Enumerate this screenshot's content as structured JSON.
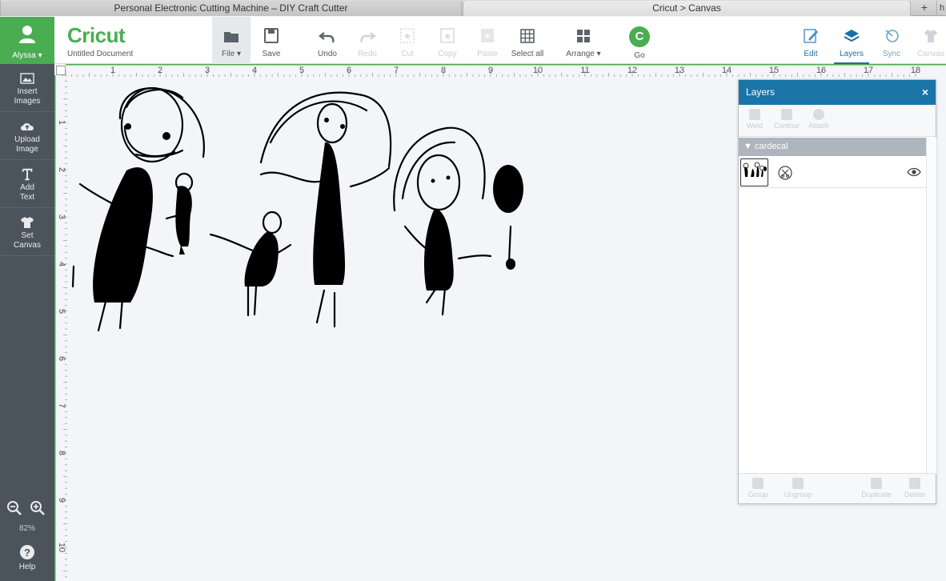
{
  "browser": {
    "tab1_title": "Personal Electronic Cutting Machine – DIY Craft Cutter",
    "tab2_title": "Cricut > Canvas",
    "new_tab": "+"
  },
  "user": {
    "name": "Alyssa"
  },
  "brand": {
    "logo": "Cricut",
    "document_title": "Untitled Document",
    "accent": "#4aad52",
    "blue": "#1b74a8"
  },
  "toolbar": {
    "file": "File",
    "save": "Save",
    "undo": "Undo",
    "redo": "Redo",
    "cut": "Cut",
    "copy": "Copy",
    "paste": "Paste",
    "select_all": "Select all",
    "arrange": "Arrange",
    "go": "Go",
    "go_glyph": "C",
    "edit": "Edit",
    "layers": "Layers",
    "sync": "Sync",
    "canvas": "Canvas"
  },
  "sidebar": {
    "insert_images_1": "Insert",
    "insert_images_2": "Images",
    "upload_image_1": "Upload",
    "upload_image_2": "Image",
    "add_text_1": "Add",
    "add_text_2": "Text",
    "set_canvas_1": "Set",
    "set_canvas_2": "Canvas",
    "zoom": "82%",
    "help": "Help"
  },
  "ruler": {
    "top": [
      "1",
      "2",
      "3",
      "4",
      "5",
      "6",
      "7",
      "8",
      "9",
      "10",
      "11",
      "12",
      "13",
      "14",
      "15",
      "16",
      "17",
      "18"
    ],
    "left": [
      "1",
      "2",
      "3",
      "4",
      "5",
      "6",
      "7",
      "8",
      "9",
      "10"
    ]
  },
  "layers_panel": {
    "title": "Layers",
    "close": "×",
    "weld": "Weld",
    "contour": "Contour",
    "attach": "Attach",
    "group_name": "cardecal",
    "group": "Group",
    "ungroup": "Ungroup",
    "duplicate": "Duplicate",
    "delete": "Delete"
  }
}
